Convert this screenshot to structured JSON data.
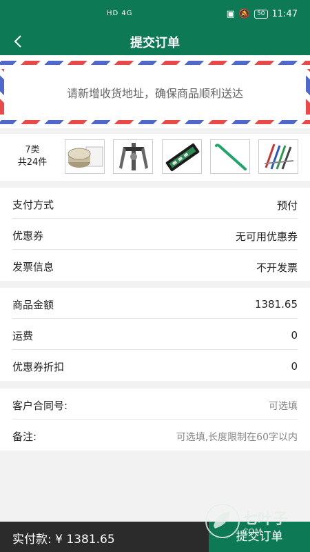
{
  "status_bar": {
    "network": "HD 4G",
    "battery": "50",
    "time": "11:47"
  },
  "header": {
    "title": "提交订单",
    "back_icon": "chevron-left-icon"
  },
  "address": {
    "hint": "请新增收货地址，确保商品顺利送达"
  },
  "goods": {
    "kinds": "7类",
    "total_items": "共24件"
  },
  "order_info": [
    {
      "label": "支付方式",
      "value": "预付"
    },
    {
      "label": "优惠券",
      "value": "无可用优惠券"
    },
    {
      "label": "发票信息",
      "value": "不开发票"
    }
  ],
  "amounts": [
    {
      "label": "商品金额",
      "value": "1381.65"
    },
    {
      "label": "运费",
      "value": "0"
    },
    {
      "label": "优惠券折扣",
      "value": "0"
    }
  ],
  "extra": {
    "contract_label": "客户合同号:",
    "contract_placeholder": "可选填",
    "note_label": "备注:",
    "note_placeholder": "可选填,长度限制在60字以内"
  },
  "footer": {
    "total_label": "实付款: ¥ 1381.65",
    "submit_label": "提交订单"
  },
  "watermark": {
    "text": "七叶子",
    "sub": "COM"
  },
  "colors": {
    "primary": "#0e7a55",
    "bottom_bar": "#2b2b2b",
    "stripe_red": "#e84a4a",
    "stripe_blue": "#4f68c9"
  }
}
